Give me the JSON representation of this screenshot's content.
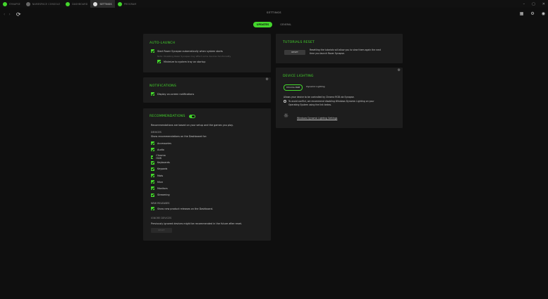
{
  "tabs": [
    {
      "label": "SYNAPSE",
      "icon": "razer-logo-icon",
      "active": false
    },
    {
      "label": "NAMESPACE CONSOLE",
      "icon": "headset-icon",
      "active": false
    },
    {
      "label": "DASHBOARD",
      "icon": "razer-logo-icon",
      "active": false
    },
    {
      "label": "SETTINGS",
      "icon": "gear-icon",
      "active": true
    },
    {
      "label": "PROGRAM",
      "icon": "razer-logo-icon",
      "active": false
    }
  ],
  "window": {
    "minimize": "–",
    "maximize": "▢",
    "close": "✕"
  },
  "header": {
    "title": "SETTINGS",
    "back": "‹",
    "forward": "›",
    "refresh": "⟳"
  },
  "header_icons": {
    "grid": "▦",
    "gear": "⚙",
    "profile": "◉"
  },
  "subtabs": [
    {
      "label": "UPDATES",
      "active": true
    },
    {
      "label": "GENERAL",
      "active": false
    }
  ],
  "autolaunch": {
    "title": "AUTO-LAUNCH",
    "start_label": "Start Razer Synapse automatically when system starts",
    "start_note": "Note: Disabling Razer Synapse may affect some devices functionality",
    "minimize_label": "Minimize to system tray on startup"
  },
  "notifications": {
    "title": "NOTIFICATIONS",
    "display_label": "Display on-screen notifications"
  },
  "recommendations": {
    "title": "RECOMMENDATIONS",
    "intro": "Recommendations are based on your setup and the games you play.",
    "devices_heading": "DEVICES",
    "devices_desc": "Show recommendations on the Dashboard for:",
    "devices": [
      "Accessories",
      "Audio",
      "Chroma HUB",
      "Keyboards",
      "Keypads",
      "Mats",
      "Mice",
      "Monitors",
      "Streaming"
    ],
    "new_releases_heading": "NEW RELEASES",
    "new_releases_label": "Show new product releases on the Dashboard.",
    "ignore_heading": "IGNORE DEVICES",
    "ignore_desc": "Previously ignored devices might be recommended in the future after reset.",
    "reset_label": "RESET"
  },
  "tutorials": {
    "title": "TUTORIALS RESET",
    "reset_label": "RESET",
    "desc_line1": "Resetting the tutorials will allow you to view them again the next",
    "desc_line2": "time you launch Razer Synapse."
  },
  "lighting": {
    "title": "DEVICE LIGHTING",
    "options": [
      {
        "label": "Chroma RGB",
        "active": true
      },
      {
        "label": "Dynamic Lighting",
        "active": false
      }
    ],
    "desc": "Allows your device to be controlled by Chroma RGB via Synapse.",
    "warn_line1": "To avoid conflict, we recommend disabling Windows Dynamic Lighting on your",
    "warn_line2": "Operating System using the link below.",
    "link_label": "Windows Dynamic Lighting Settings"
  },
  "colors": {
    "accent": "#44d62c",
    "panel": "#1d1d1d",
    "background": "#0f0f0f"
  }
}
